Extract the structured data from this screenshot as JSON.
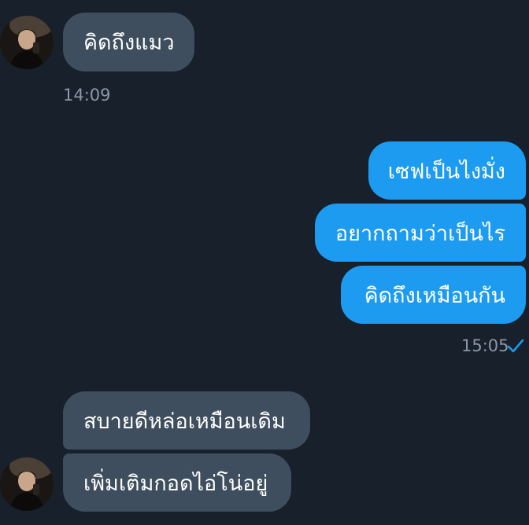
{
  "messages": {
    "m1": {
      "text": "คิดถึงแมว"
    },
    "t1": "14:09",
    "m2": {
      "text": "เซฟเป็นไงมั่ง"
    },
    "m3": {
      "text": "อยากถามว่าเป็นไร"
    },
    "m4": {
      "text": "คิดถึงเหมือนกัน"
    },
    "t2": "15:05",
    "m5": {
      "text": "สบายดีหล่อเหมือนเดิม"
    },
    "m6": {
      "text": "เพิ่มเติมกอดไอ่โน่อยู่"
    }
  },
  "colors": {
    "background": "#17202b",
    "incoming_bubble": "#3e4e5e",
    "outgoing_bubble": "#1c9bf0",
    "timestamp": "#8b98a5",
    "read_check": "#1c9bf0"
  },
  "icons": {
    "read_receipt": "check-icon",
    "avatar": "avatar"
  }
}
